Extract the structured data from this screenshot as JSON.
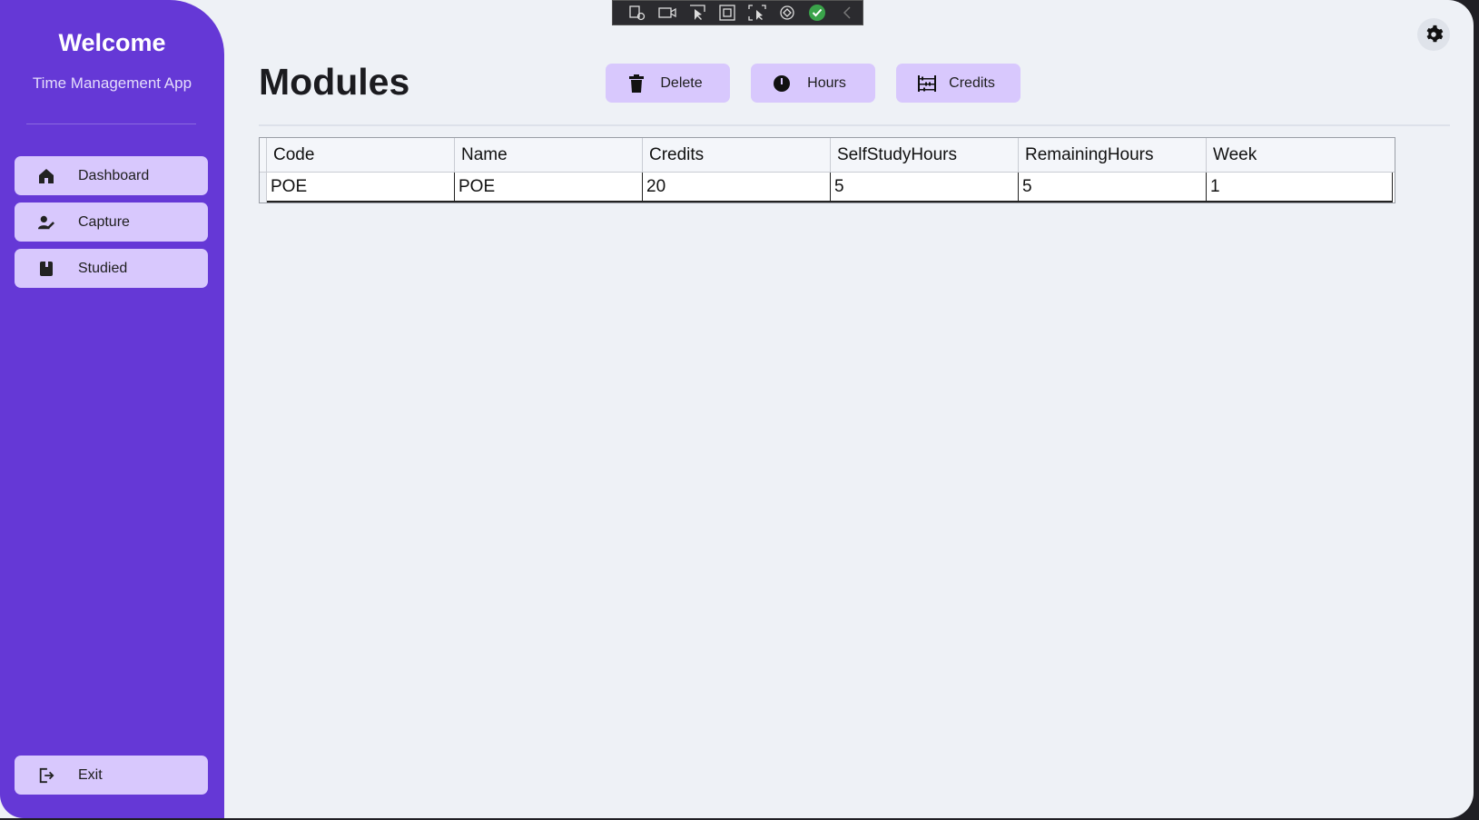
{
  "sidebar": {
    "title": "Welcome",
    "subtitle": "Time Management App",
    "items": [
      {
        "label": "Dashboard",
        "icon": "home-icon"
      },
      {
        "label": "Capture",
        "icon": "user-edit-icon"
      },
      {
        "label": "Studied",
        "icon": "book-icon"
      }
    ],
    "exit_label": "Exit"
  },
  "main": {
    "title": "Modules",
    "actions": {
      "delete_label": "Delete",
      "hours_label": "Hours",
      "credits_label": "Credits"
    },
    "grid": {
      "columns": [
        "Code",
        "Name",
        "Credits",
        "SelfStudyHours",
        "RemainingHours",
        "Week"
      ],
      "rows": [
        [
          "POE",
          "POE",
          "20",
          "5",
          "5",
          "1"
        ]
      ]
    }
  },
  "colors": {
    "sidebar_bg": "#6538d6",
    "button_bg": "#d8c8fd",
    "page_bg": "#eef1f6"
  }
}
